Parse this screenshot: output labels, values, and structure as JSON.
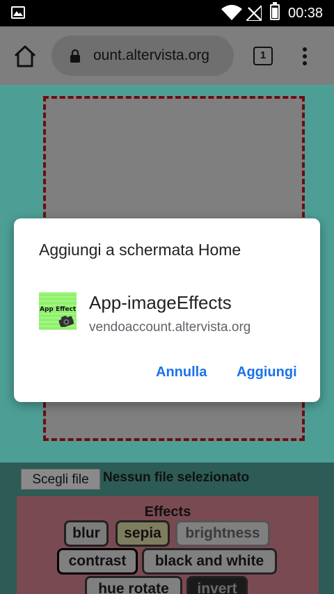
{
  "status_bar": {
    "time": "00:38",
    "icons": [
      "gallery-icon",
      "wifi-icon",
      "no-signal-icon",
      "battery-icon"
    ]
  },
  "browser": {
    "url": "ount.altervista.org",
    "tab_count": "1",
    "icons": [
      "home-icon",
      "lock-icon",
      "tab-switcher-icon",
      "more-menu-icon"
    ]
  },
  "page": {
    "file_button_label": "Scegli file",
    "file_status": "Nessun file selezionato",
    "effects_title": "Effects",
    "effects": [
      "blur",
      "sepia",
      "brightness",
      "contrast",
      "black and white",
      "hue rotate",
      "invert"
    ]
  },
  "dialog": {
    "title": "Aggiungi a schermata Home",
    "app_icon_label": "App Effect",
    "app_name": "App-imageEffects",
    "app_url": "vendoaccount.altervista.org",
    "cancel_label": "Annulla",
    "add_label": "Aggiungi"
  },
  "colors": {
    "accent": "#1a73e8",
    "status_bar": "#000000",
    "page_background": "#4d9f96",
    "drop_border": "#6b0e12",
    "effects_panel": "#7a4a52"
  }
}
